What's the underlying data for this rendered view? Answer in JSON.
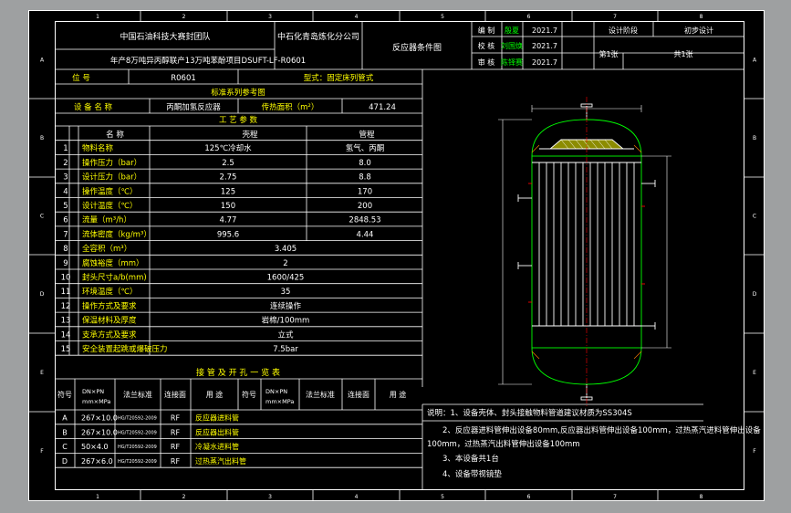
{
  "colors": {
    "background": "#9ea0a1",
    "sheet": "#000000",
    "line": "#ffffff",
    "yellow": "#ffff00",
    "green": "#00ff00",
    "magenta": "#ff00ff",
    "red": "#ff0000",
    "orange": "#ff8000",
    "gray": "#808080"
  },
  "border_labels": {
    "cols": [
      "1",
      "2",
      "3",
      "4",
      "5",
      "6",
      "7",
      "8"
    ],
    "rows": [
      "A",
      "B",
      "C",
      "D",
      "E",
      "F"
    ]
  },
  "title_block": {
    "org": "中国石油科技大赛封团队",
    "company": "中石化青岛炼化分公司",
    "project": "年产8万吨异丙醇联产13万吨苯酚项目DSUFT-LF-R0601",
    "drawing_title": "反应器条件图",
    "roles": [
      {
        "role": "编 制",
        "name": "殷夏",
        "date": "2021.7"
      },
      {
        "role": "校 核",
        "name": "刘国焕",
        "date": "2021.7"
      },
      {
        "role": "审 核",
        "name": "陈铎赛",
        "date": "2021.7"
      }
    ],
    "stage_label": "设计阶段",
    "stage_value": "初步设计",
    "sheet_no": "第1张",
    "sheet_total": "共1张"
  },
  "spec": {
    "position_label": "位 号",
    "position_value": "R0601",
    "type_label": "型式：固定床列管式",
    "reference": "标准系列参考图",
    "device_label": "设 备 名 称",
    "device_value": "丙酮加氢反应器",
    "area_label": "传热面积（m²）",
    "area_value": "471.24",
    "section_title": "工 艺 参 数",
    "col_name": "名 称",
    "col_shell": "壳程",
    "col_tube": "管程",
    "rows": [
      {
        "no": "1",
        "name": "物料名称",
        "shell": "125℃冷却水",
        "tube": "氢气、丙酮"
      },
      {
        "no": "2",
        "name": "操作压力（bar）",
        "shell": "2.5",
        "tube": "8.0"
      },
      {
        "no": "3",
        "name": "设计压力（bar）",
        "shell": "2.75",
        "tube": "8.8"
      },
      {
        "no": "4",
        "name": "操作温度（℃）",
        "shell": "125",
        "tube": "170"
      },
      {
        "no": "5",
        "name": "设计温度（℃）",
        "shell": "150",
        "tube": "200"
      },
      {
        "no": "6",
        "name": "流量（m³/h）",
        "shell": "4.77",
        "tube": "2848.53"
      },
      {
        "no": "7",
        "name": "流体密度（kg/m³）",
        "shell": "995.6",
        "tube": "4.44"
      },
      {
        "no": "8",
        "name": "全容积（m³）",
        "merged": "3.405"
      },
      {
        "no": "9",
        "name": "腐蚀裕度（mm）",
        "merged": "2"
      },
      {
        "no": "10",
        "name": "封头尺寸a/b(mm)",
        "merged": "1600/425"
      },
      {
        "no": "11",
        "name": "环境温度（℃）",
        "merged": "35"
      },
      {
        "no": "12",
        "name": "操作方式及要求",
        "merged": "连续操作"
      },
      {
        "no": "13",
        "name": "保温材料及厚度",
        "merged": "岩棉/100mm"
      },
      {
        "no": "14",
        "name": "支承方式及要求",
        "merged": "立式"
      },
      {
        "no": "15",
        "name": "安全装置起跳或爆破压力",
        "merged": "7.5bar"
      }
    ]
  },
  "nozzles": {
    "title": "接 管 及 开 孔 一 览 表",
    "headers": {
      "code": "符号",
      "dn": "DN×PN",
      "unit": "mm×MPa",
      "std": "法兰标准",
      "face": "连接面",
      "use": "用 途"
    },
    "rows": [
      {
        "code": "A",
        "dn": "267×10.0",
        "std": "HG/T20592-2009",
        "face": "RF",
        "use": "反应器进料管"
      },
      {
        "code": "B",
        "dn": "267×10.0",
        "std": "HG/T20592-2009",
        "face": "RF",
        "use": "反应器出料管"
      },
      {
        "code": "C",
        "dn": "50×4.0",
        "std": "HG/T20592-2009",
        "face": "RF",
        "use": "冷凝水进料管"
      },
      {
        "code": "D",
        "dn": "267×6.0",
        "std": "HG/T20592-2009",
        "face": "RF",
        "use": "过热蒸汽出料管"
      }
    ]
  },
  "notes": [
    "说明：1、设备壳体、封头接触物料管道建议材质为SS304S",
    "2、反应器进料管伸出设备80mm,反应器出料管伸出设备100mm，过热蒸汽进料管伸出设备",
    "100mm，过热蒸汽出料管伸出设备100mm",
    "3、本设备共1台",
    "4、设备带视镜垫"
  ]
}
